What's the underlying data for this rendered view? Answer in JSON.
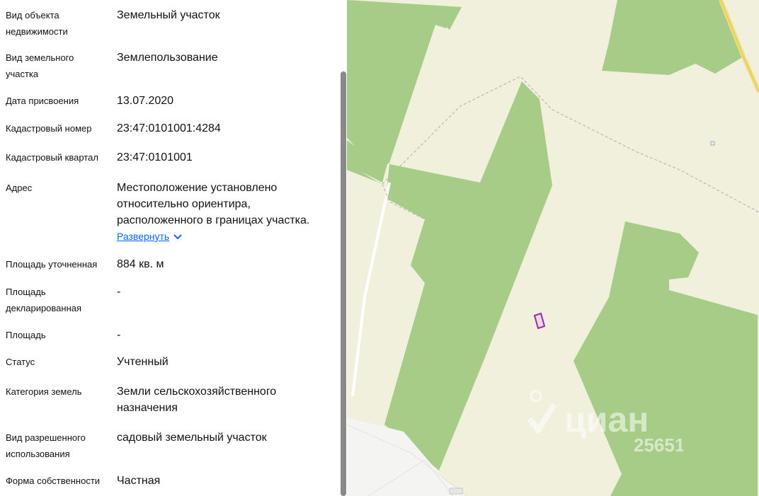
{
  "fields": [
    {
      "label": "Вид объекта недвижимости",
      "value": "Земельный участок"
    },
    {
      "label": "Вид земельного участка",
      "value": "Землепользование"
    },
    {
      "label": "Дата присвоения",
      "value": "13.07.2020"
    },
    {
      "label": "Кадастровый номер",
      "value": "23:47:0101001:4284"
    },
    {
      "label": "Кадастровый квартал",
      "value": "23:47:0101001"
    },
    {
      "label": "Адрес",
      "value": "Местоположение установлено относительно ориентира, расположенного в границах участка."
    },
    {
      "label": "Площадь уточненная",
      "value": "884 кв. м"
    },
    {
      "label": "Площадь декларированная",
      "value": "-"
    },
    {
      "label": "Площадь",
      "value": "-"
    },
    {
      "label": "Статус",
      "value": "Учтенный"
    },
    {
      "label": "Категория земель",
      "value": "Земли сельскохозяйственного назначения"
    },
    {
      "label": "Вид разрешенного использования",
      "value": "садовый земельный участок"
    },
    {
      "label": "Форма собственности",
      "value": "Частная"
    }
  ],
  "address_expand": {
    "label": "Развернуть",
    "icon": "chevron-down-icon"
  },
  "map": {
    "watermark_logo": "циан",
    "watermark_number": "25651",
    "colors": {
      "land": "#f0f0dd",
      "forest": "#a6cc87",
      "road_yellow": "#f3dc7a",
      "road_white": "#ffffff",
      "plot": "#9c27b0"
    }
  }
}
